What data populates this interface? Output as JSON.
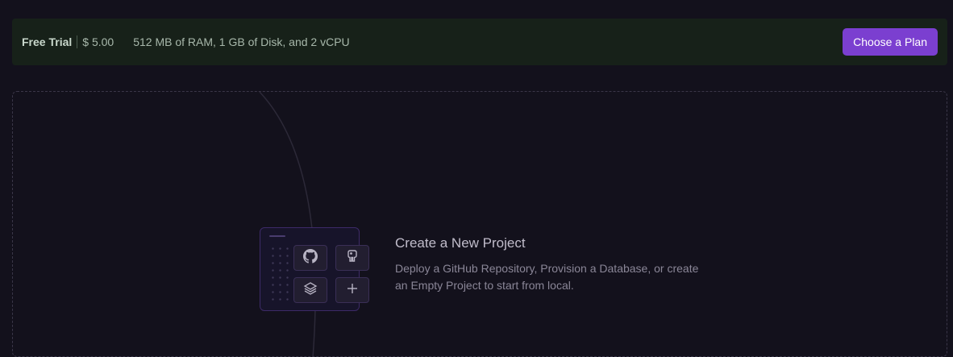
{
  "trial_bar": {
    "plan_name": "Free Trial",
    "credit": "$ 5.00",
    "specs": "512 MB of RAM, 1 GB of Disk, and 2 vCPU",
    "cta_label": "Choose a Plan"
  },
  "empty_state": {
    "title": "Create a New Project",
    "description": "Deploy a GitHub Repository, Provision a Database, or create an Empty Project to start from local.",
    "tiles": [
      {
        "icon": "github-icon"
      },
      {
        "icon": "postgres-elephant-icon"
      },
      {
        "icon": "layers-icon"
      },
      {
        "icon": "plus-icon"
      }
    ]
  },
  "colors": {
    "background": "#13111c",
    "trial_bar": "#172119",
    "accent": "#7b3fd0"
  }
}
